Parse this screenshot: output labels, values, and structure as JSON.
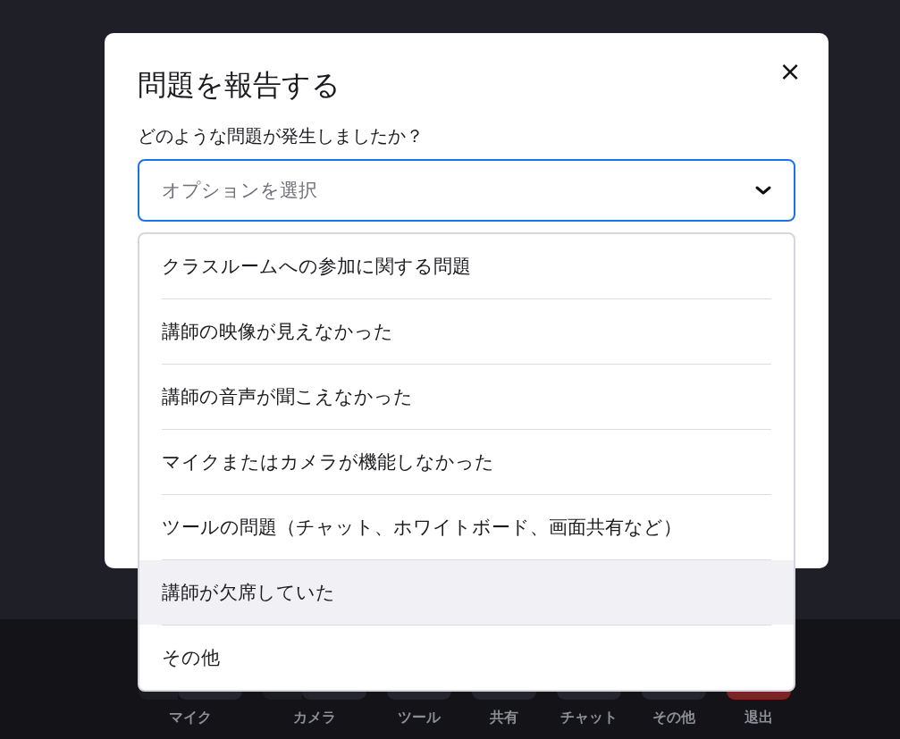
{
  "dialog": {
    "title": "問題を報告する",
    "close": "×",
    "question": "どのような問題が発生しましたか？",
    "select": {
      "placeholder": "オプションを選択",
      "expanded": true,
      "options": [
        {
          "label": "クラスルームへの参加に関する問題",
          "highlighted": false
        },
        {
          "label": "講師の映像が見えなかった",
          "highlighted": false
        },
        {
          "label": "講師の音声が聞こえなかった",
          "highlighted": false
        },
        {
          "label": "マイクまたはカメラが機能しなかった",
          "highlighted": false
        },
        {
          "label": "ツールの問題（チャット、ホワイトボード、画面共有など）",
          "highlighted": false
        },
        {
          "label": "講師が欠席していた",
          "highlighted": true
        },
        {
          "label": "その他",
          "highlighted": false
        }
      ]
    }
  },
  "toolbar": [
    {
      "label": "マイク",
      "kind": "split"
    },
    {
      "label": "カメラ",
      "kind": "split"
    },
    {
      "label": "ツール",
      "kind": "single"
    },
    {
      "label": "共有",
      "kind": "single"
    },
    {
      "label": "チャット",
      "kind": "single"
    },
    {
      "label": "その他",
      "kind": "single"
    },
    {
      "label": "退出",
      "kind": "danger"
    }
  ]
}
